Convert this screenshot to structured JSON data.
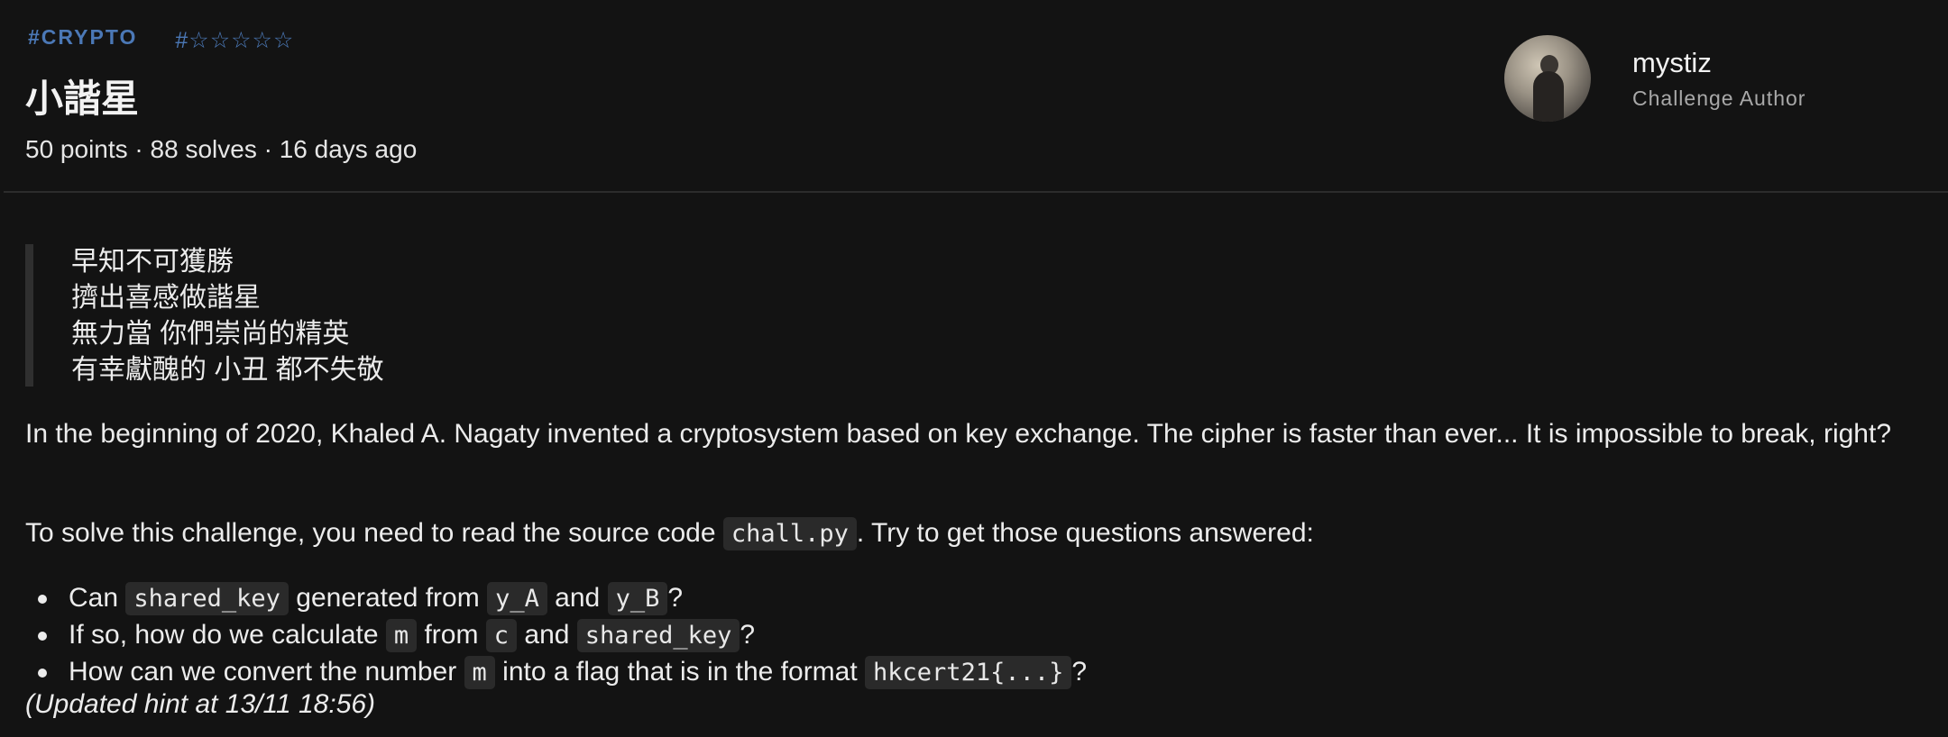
{
  "tags": [
    "#CRYPTO",
    "#☆☆☆☆☆"
  ],
  "title": "小諧星",
  "meta": "50 points · 88 solves · 16 days ago",
  "author": {
    "name": "mystiz",
    "role": "Challenge Author"
  },
  "quote": [
    "早知不可獲勝",
    "擠出喜感做諧星",
    "無力當 你們崇尚的精英",
    "有幸獻醜的 小丑 都不失敬"
  ],
  "para1": "In the beginning of 2020, Khaled A. Nagaty invented a cryptosystem based on key exchange. The cipher is faster than ever... It is impossible to break, right?",
  "para2": {
    "before": "To solve this challenge, you need to read the source code ",
    "code": "chall.py",
    "after": ". Try to get those questions answered:"
  },
  "questions": [
    {
      "t1": "Can ",
      "c1": "shared_key",
      "t2": " generated from ",
      "c2": "y_A",
      "t3": " and ",
      "c3": "y_B",
      "t4": "?"
    },
    {
      "t1": "If so, how do we calculate ",
      "c1": "m",
      "t2": " from ",
      "c2": "c",
      "t3": " and ",
      "c3": "shared_key",
      "t4": "?"
    },
    {
      "t1": "How can we convert the number ",
      "c1": "m",
      "t2": " into a flag that is in the format ",
      "c2": "hkcert21{...}",
      "t3": "?"
    }
  ],
  "hint": "(Updated hint at 13/11 18:56)",
  "colors": {
    "background": "#131313",
    "tag": "#4b78b6",
    "code_bg": "#2a2a2a"
  }
}
